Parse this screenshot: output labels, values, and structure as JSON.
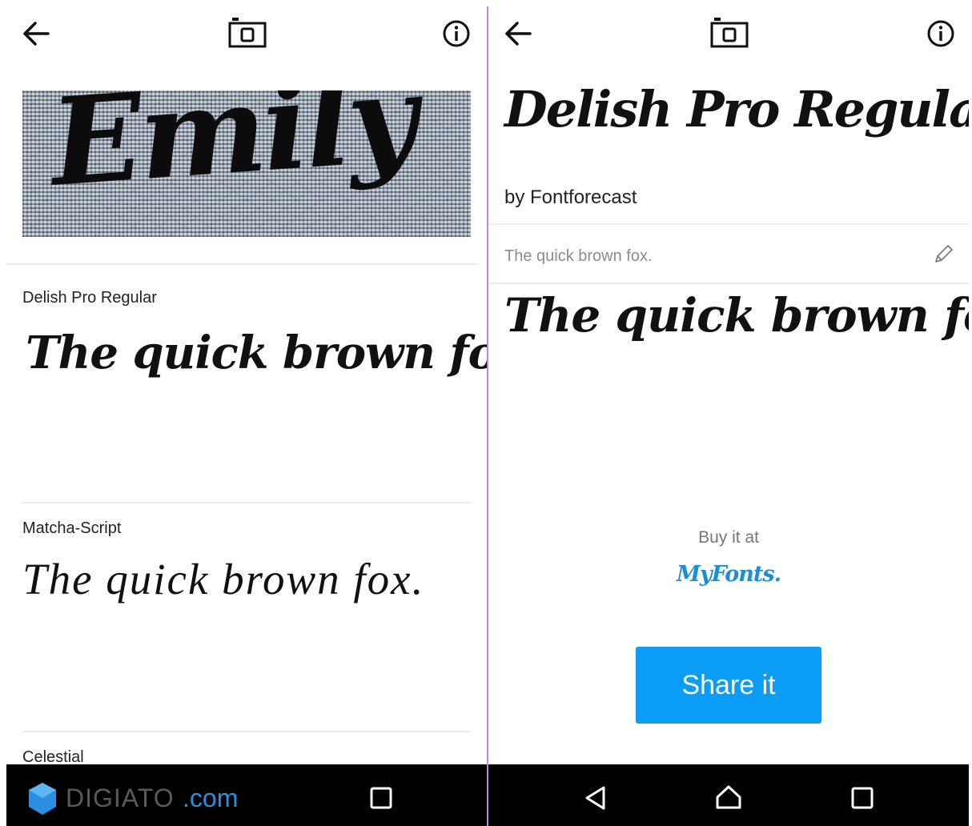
{
  "left_screen": {
    "photo_text": "Emily",
    "results": [
      {
        "name": "Delish Pro Regular",
        "sample": "The quick brown fox."
      },
      {
        "name": "Matcha-Script",
        "sample": "The quick brown fox."
      },
      {
        "name": "Celestial"
      }
    ],
    "watermark": {
      "prefix": "DIGIATO",
      "suffix": ".com"
    }
  },
  "right_screen": {
    "font_title": "Delish Pro Regular",
    "author": "by Fontforecast",
    "sample_input_text": "The quick brown fox.",
    "preview": "The quick brown fox.",
    "buy_label": "Buy it at",
    "vendor_logo_text": "MyFonts.",
    "share_button": "Share it"
  },
  "colors": {
    "accent": "#0b9cf5",
    "vendor": "#1a8fd8",
    "divider": "#b48be0",
    "navbar": "#000000"
  },
  "icons": [
    "back-arrow-icon",
    "camera-icon",
    "info-icon",
    "pencil-icon",
    "nav-back-icon",
    "nav-home-icon",
    "nav-recents-icon",
    "digiato-logo-icon"
  ]
}
